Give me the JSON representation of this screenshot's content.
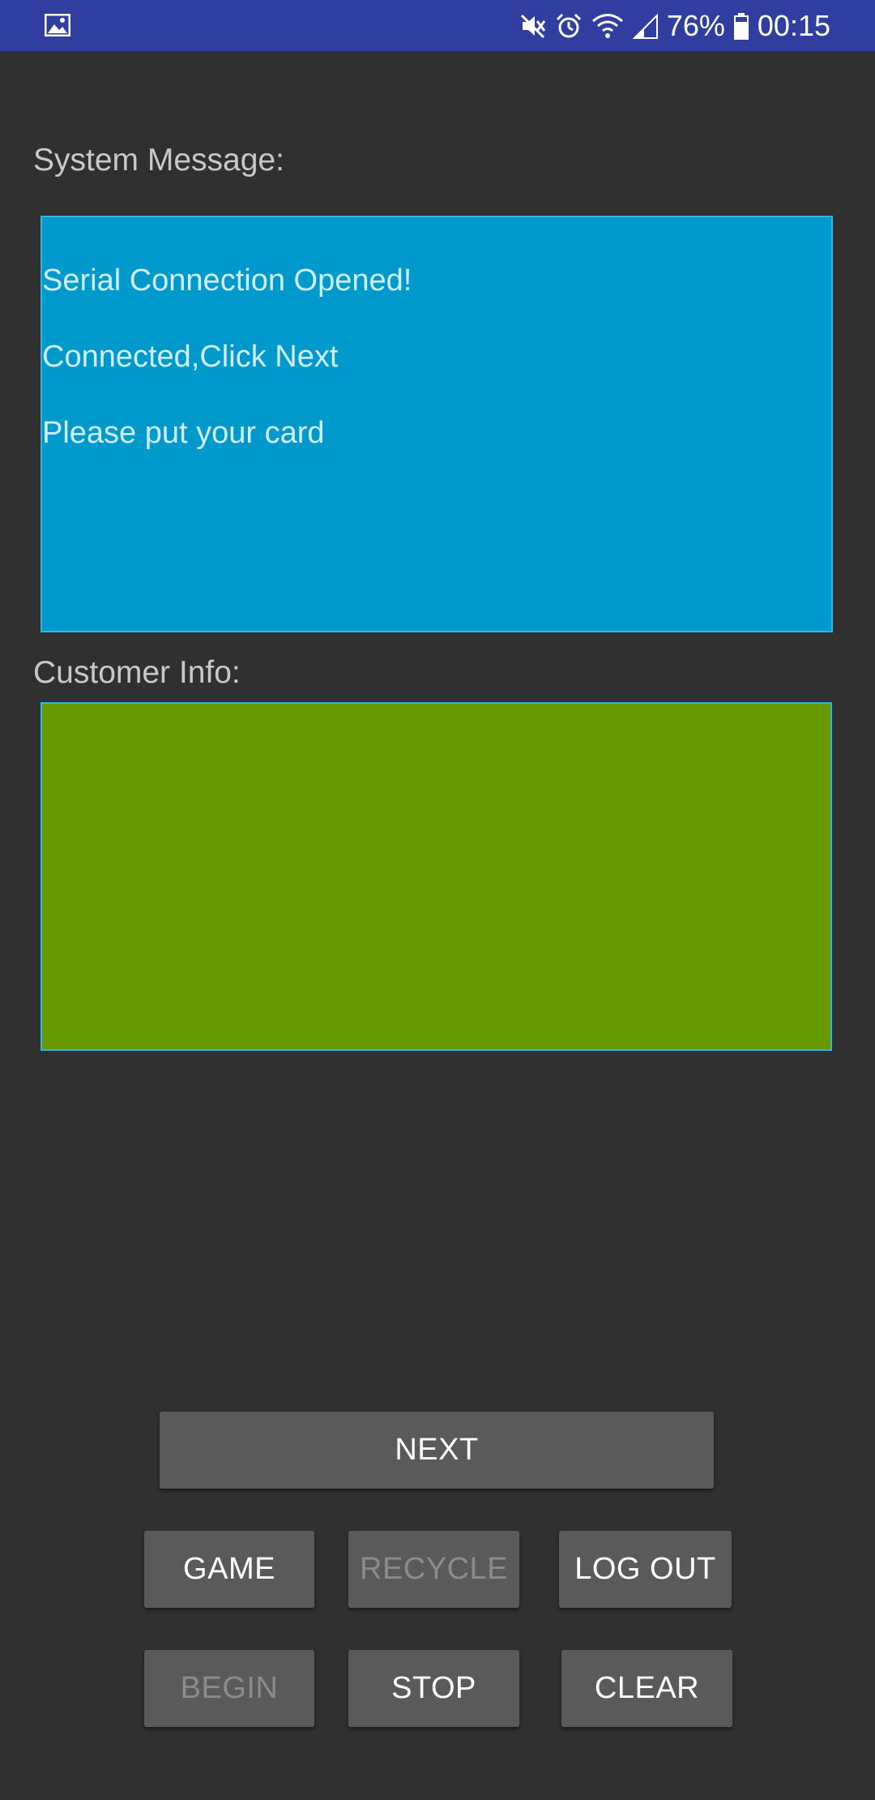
{
  "status_bar": {
    "battery_percent": "76%",
    "time": "00:15",
    "icons": [
      "image-notification-icon",
      "mute-icon",
      "alarm-icon",
      "wifi-icon",
      "signal-icon",
      "battery-icon"
    ],
    "background_color": "#303f9f"
  },
  "system_message": {
    "label": "System Message:",
    "lines": [
      "Serial Connection Opened!",
      "Connected,Click Next",
      "Please put your card"
    ],
    "background_color": "#0099cc"
  },
  "customer_info": {
    "label": "Customer Info:",
    "background_color": "#669900"
  },
  "buttons": {
    "next": "NEXT",
    "game": "GAME",
    "recycle": "RECYCLE",
    "log_out": "LOG OUT",
    "begin": "BEGIN",
    "stop": "STOP",
    "clear": "CLEAR"
  }
}
